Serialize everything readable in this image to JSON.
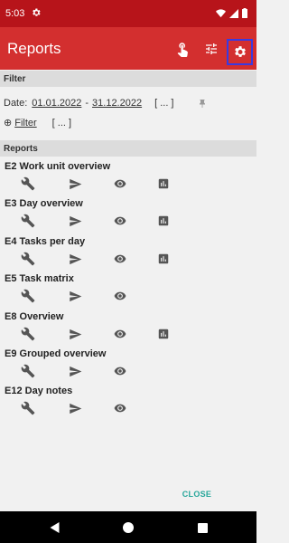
{
  "status_bar": {
    "time": "5:03"
  },
  "app_bar": {
    "title": "Reports",
    "icons": [
      "touch-icon",
      "tune-icon",
      "settings-icon"
    ]
  },
  "filter": {
    "header": "Filter",
    "date_label": "Date:",
    "date_from": "01.01.2022",
    "date_separator": "-",
    "date_to": "31.12.2022",
    "date_more": "[ ... ]",
    "filter_prefix": "⊕",
    "filter_link": "Filter",
    "filter_more": "[ ... ]"
  },
  "reports": {
    "header": "Reports",
    "items": [
      {
        "title": "E2 Work unit overview"
      },
      {
        "title": "E3 Day overview"
      },
      {
        "title": "E4 Tasks per day"
      },
      {
        "title": "E5 Task matrix"
      },
      {
        "title": "E8 Overview"
      },
      {
        "title": "E9 Grouped overview"
      },
      {
        "title": "E12 Day notes"
      }
    ]
  },
  "footer": {
    "close_label": "CLOSE"
  },
  "colors": {
    "status_bar": "#b7141a",
    "app_bar": "#d32f2f",
    "accent": "#26a69a",
    "icon_gray": "#555555"
  }
}
